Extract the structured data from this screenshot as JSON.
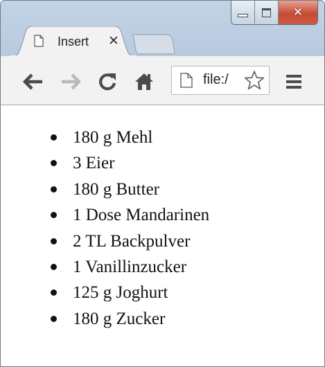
{
  "window": {
    "caption_buttons": {
      "minimize_icon": "minimize-icon",
      "maximize_icon": "maximize-icon",
      "close_glyph": "✕"
    }
  },
  "tabs": [
    {
      "title": "Insert",
      "close_glyph": "✕",
      "icon": "page-icon"
    }
  ],
  "toolbar": {
    "back_icon": "back-arrow-icon",
    "forward_icon": "forward-arrow-icon",
    "reload_icon": "reload-icon",
    "home_icon": "home-icon",
    "omnibox": {
      "icon": "page-icon",
      "url_text": "file:/",
      "star_icon": "star-icon"
    },
    "menu_icon": "hamburger-menu-icon"
  },
  "content": {
    "list_items": [
      "180 g Mehl",
      "3 Eier",
      "180 g Butter",
      "1 Dose Mandarinen",
      "2 TL Backpulver",
      "1 Vanillinzucker",
      "125 g Joghurt",
      "180 g Zucker"
    ]
  },
  "colors": {
    "titlebar": "#c3d3e6",
    "close_button": "#c64b35",
    "toolbar": "#f2f2f2",
    "content_bg": "#ffffff",
    "text": "#111111"
  }
}
